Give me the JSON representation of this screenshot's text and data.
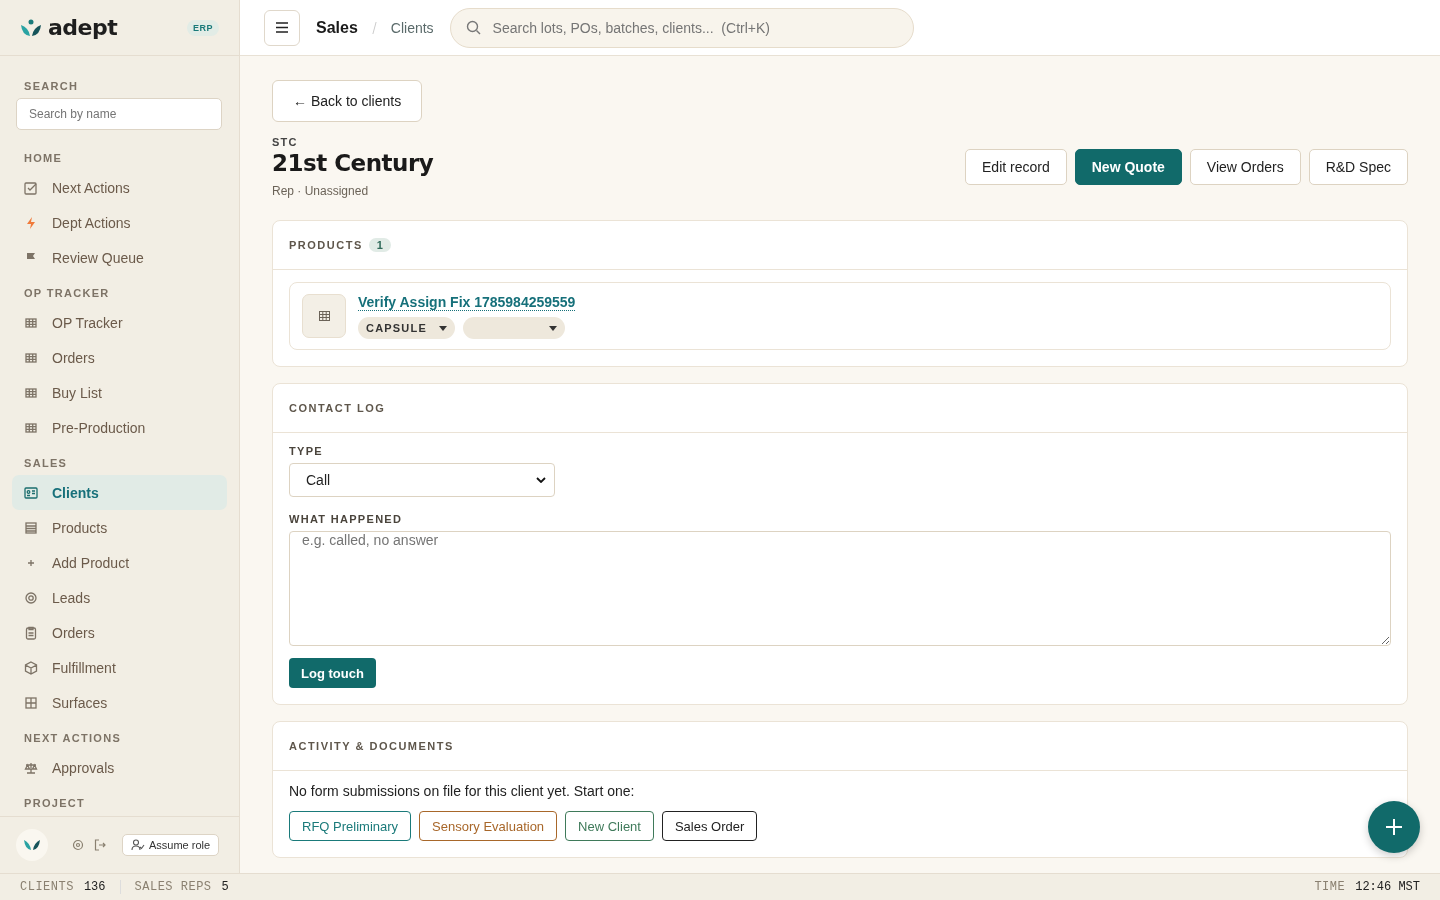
{
  "brand": {
    "name": "adept",
    "badge": "ERP"
  },
  "sidebar": {
    "search": {
      "label": "SEARCH",
      "placeholder": "Search by name"
    },
    "sections": [
      {
        "title": "HOME",
        "items": [
          {
            "label": "Next Actions",
            "kind": "check",
            "selected": false
          },
          {
            "label": "Dept Actions",
            "kind": "bolt",
            "selected": false
          },
          {
            "label": "Review Queue",
            "kind": "flag",
            "selected": false
          }
        ]
      },
      {
        "title": "OP TRACKER",
        "items": [
          {
            "label": "OP Tracker",
            "kind": "grid",
            "selected": false
          },
          {
            "label": "Orders",
            "kind": "grid",
            "selected": false
          },
          {
            "label": "Buy List",
            "kind": "grid",
            "selected": false
          },
          {
            "label": "Pre-Production",
            "kind": "grid",
            "selected": false
          }
        ]
      },
      {
        "title": "SALES",
        "items": [
          {
            "label": "Clients",
            "kind": "card",
            "selected": true
          },
          {
            "label": "Products",
            "kind": "list",
            "selected": false
          },
          {
            "label": "Add Product",
            "kind": "plus",
            "selected": false
          },
          {
            "label": "Leads",
            "kind": "target",
            "selected": false
          },
          {
            "label": "Orders",
            "kind": "clipboard",
            "selected": false
          },
          {
            "label": "Fulfillment",
            "kind": "box",
            "selected": false
          },
          {
            "label": "Surfaces",
            "kind": "squares",
            "selected": false
          }
        ]
      },
      {
        "title": "NEXT ACTIONS",
        "items": [
          {
            "label": "Approvals",
            "kind": "scales",
            "selected": false
          }
        ]
      },
      {
        "title": "PROJECT"
      }
    ],
    "footer": {
      "assume_role": "Assume role"
    }
  },
  "topbar": {
    "breadcrumb": [
      "Sales",
      "Clients"
    ],
    "search_placeholder": "Search lots, POs, batches, clients...  (Ctrl+K)"
  },
  "back_button": "← Back to clients",
  "client": {
    "code": "STC",
    "name": "21st Century",
    "rep": "Rep · Unassigned"
  },
  "actions": [
    {
      "label": "Edit record",
      "primary": false
    },
    {
      "label": "New Quote",
      "primary": true
    },
    {
      "label": "View Orders",
      "primary": false
    },
    {
      "label": "R&D Spec",
      "primary": false
    }
  ],
  "products": {
    "title": "PRODUCTS",
    "count": "1",
    "items": [
      {
        "name": "Verify Assign Fix 1785984259559",
        "format": "CAPSULE"
      }
    ]
  },
  "contact_log": {
    "title": "CONTACT LOG",
    "type_label": "TYPE",
    "type_value": "Call",
    "what_label": "WHAT HAPPENED",
    "what_placeholder": "e.g. called, no answer",
    "submit": "Log touch"
  },
  "activity": {
    "title": "ACTIVITY & DOCUMENTS",
    "message": "No form submissions on file for this client yet. Start one:",
    "forms": [
      {
        "label": "RFQ Preliminary",
        "color": "#1a7a7a"
      },
      {
        "label": "Sensory Evaluation",
        "color": "#a8672a"
      },
      {
        "label": "New Client",
        "color": "#3f7a5a"
      },
      {
        "label": "Sales Order",
        "color": "#222222"
      }
    ]
  },
  "status_bar": {
    "left": [
      {
        "label": "CLIENTS",
        "value": "136"
      },
      {
        "label": "SALES REPS",
        "value": "5"
      }
    ],
    "right": {
      "label": "TIME",
      "value": "12:46 MST"
    }
  }
}
